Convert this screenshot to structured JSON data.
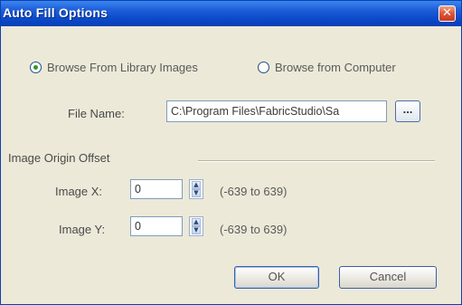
{
  "window": {
    "title": "Auto Fill Options",
    "close_glyph": "✕"
  },
  "source": {
    "option_library": "Browse From Library Images",
    "option_computer": "Browse from Computer",
    "selected": "library"
  },
  "file": {
    "label": "File Name:",
    "value": "C:\\Program Files\\FabricStudio\\Sa",
    "browse_label": "..."
  },
  "offset": {
    "section_label": "Image Origin Offset",
    "x_label": "Image X:",
    "x_value": "0",
    "x_range": "(-639 to 639)",
    "y_label": "Image Y:",
    "y_value": "0",
    "y_range": "(-639 to 639)"
  },
  "buttons": {
    "ok": "OK",
    "cancel": "Cancel"
  },
  "icons": {
    "spin_up": "▲",
    "spin_down": "▼"
  }
}
